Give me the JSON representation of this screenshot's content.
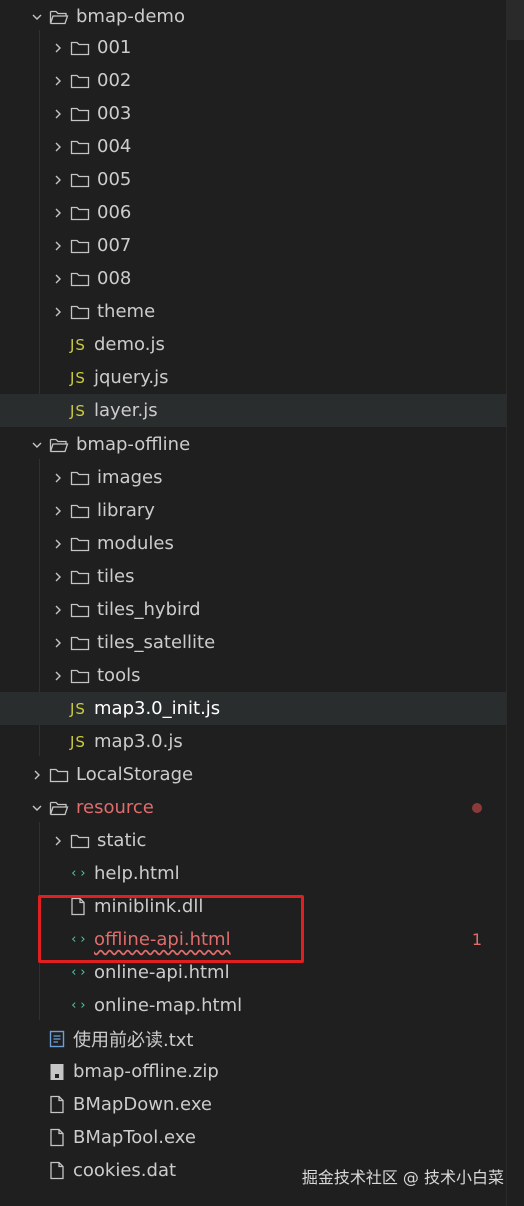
{
  "explorer": {
    "items": [
      {
        "label": "bmap-demo",
        "type": "folder-open",
        "depth": 0
      },
      {
        "label": "001",
        "type": "folder",
        "depth": 1
      },
      {
        "label": "002",
        "type": "folder",
        "depth": 1
      },
      {
        "label": "003",
        "type": "folder",
        "depth": 1
      },
      {
        "label": "004",
        "type": "folder",
        "depth": 1
      },
      {
        "label": "005",
        "type": "folder",
        "depth": 1
      },
      {
        "label": "006",
        "type": "folder",
        "depth": 1
      },
      {
        "label": "007",
        "type": "folder",
        "depth": 1
      },
      {
        "label": "008",
        "type": "folder",
        "depth": 1
      },
      {
        "label": "theme",
        "type": "folder",
        "depth": 1
      },
      {
        "label": "demo.js",
        "type": "js",
        "depth": 1
      },
      {
        "label": "jquery.js",
        "type": "js",
        "depth": 1
      },
      {
        "label": "layer.js",
        "type": "js",
        "depth": 1
      },
      {
        "label": "bmap-offline",
        "type": "folder-open",
        "depth": 0
      },
      {
        "label": "images",
        "type": "folder",
        "depth": 1
      },
      {
        "label": "library",
        "type": "folder",
        "depth": 1
      },
      {
        "label": "modules",
        "type": "folder",
        "depth": 1
      },
      {
        "label": "tiles",
        "type": "folder",
        "depth": 1
      },
      {
        "label": "tiles_hybird",
        "type": "folder",
        "depth": 1
      },
      {
        "label": "tiles_satellite",
        "type": "folder",
        "depth": 1
      },
      {
        "label": "tools",
        "type": "folder",
        "depth": 1
      },
      {
        "label": "map3.0_init.js",
        "type": "js",
        "depth": 1
      },
      {
        "label": "map3.0.js",
        "type": "js",
        "depth": 1
      },
      {
        "label": "LocalStorage",
        "type": "folder",
        "depth": 0
      },
      {
        "label": "resource",
        "type": "folder-open",
        "depth": 0
      },
      {
        "label": "static",
        "type": "folder",
        "depth": 1
      },
      {
        "label": "help.html",
        "type": "html",
        "depth": 1
      },
      {
        "label": "miniblink.dll",
        "type": "file",
        "depth": 1
      },
      {
        "label": "offline-api.html",
        "type": "html",
        "depth": 1
      },
      {
        "label": "online-api.html",
        "type": "html",
        "depth": 1
      },
      {
        "label": "online-map.html",
        "type": "html",
        "depth": 1
      },
      {
        "label": "使用前必读.txt",
        "type": "txt",
        "depth": 0
      },
      {
        "label": "bmap-offline.zip",
        "type": "zip",
        "depth": 0
      },
      {
        "label": "BMapDown.exe",
        "type": "file",
        "depth": 0
      },
      {
        "label": "BMapTool.exe",
        "type": "file",
        "depth": 0
      },
      {
        "label": "cookies.dat",
        "type": "file",
        "depth": 0
      }
    ],
    "error_count": "1"
  },
  "watermark": "掘金技术社区 @ 技术小白菜",
  "colors": {
    "background": "#1f1f1f",
    "error": "#e06c6c",
    "js_icon": "#cbcb41",
    "html_icon": "#4ec9b0",
    "highlight_box": "#e02020"
  }
}
